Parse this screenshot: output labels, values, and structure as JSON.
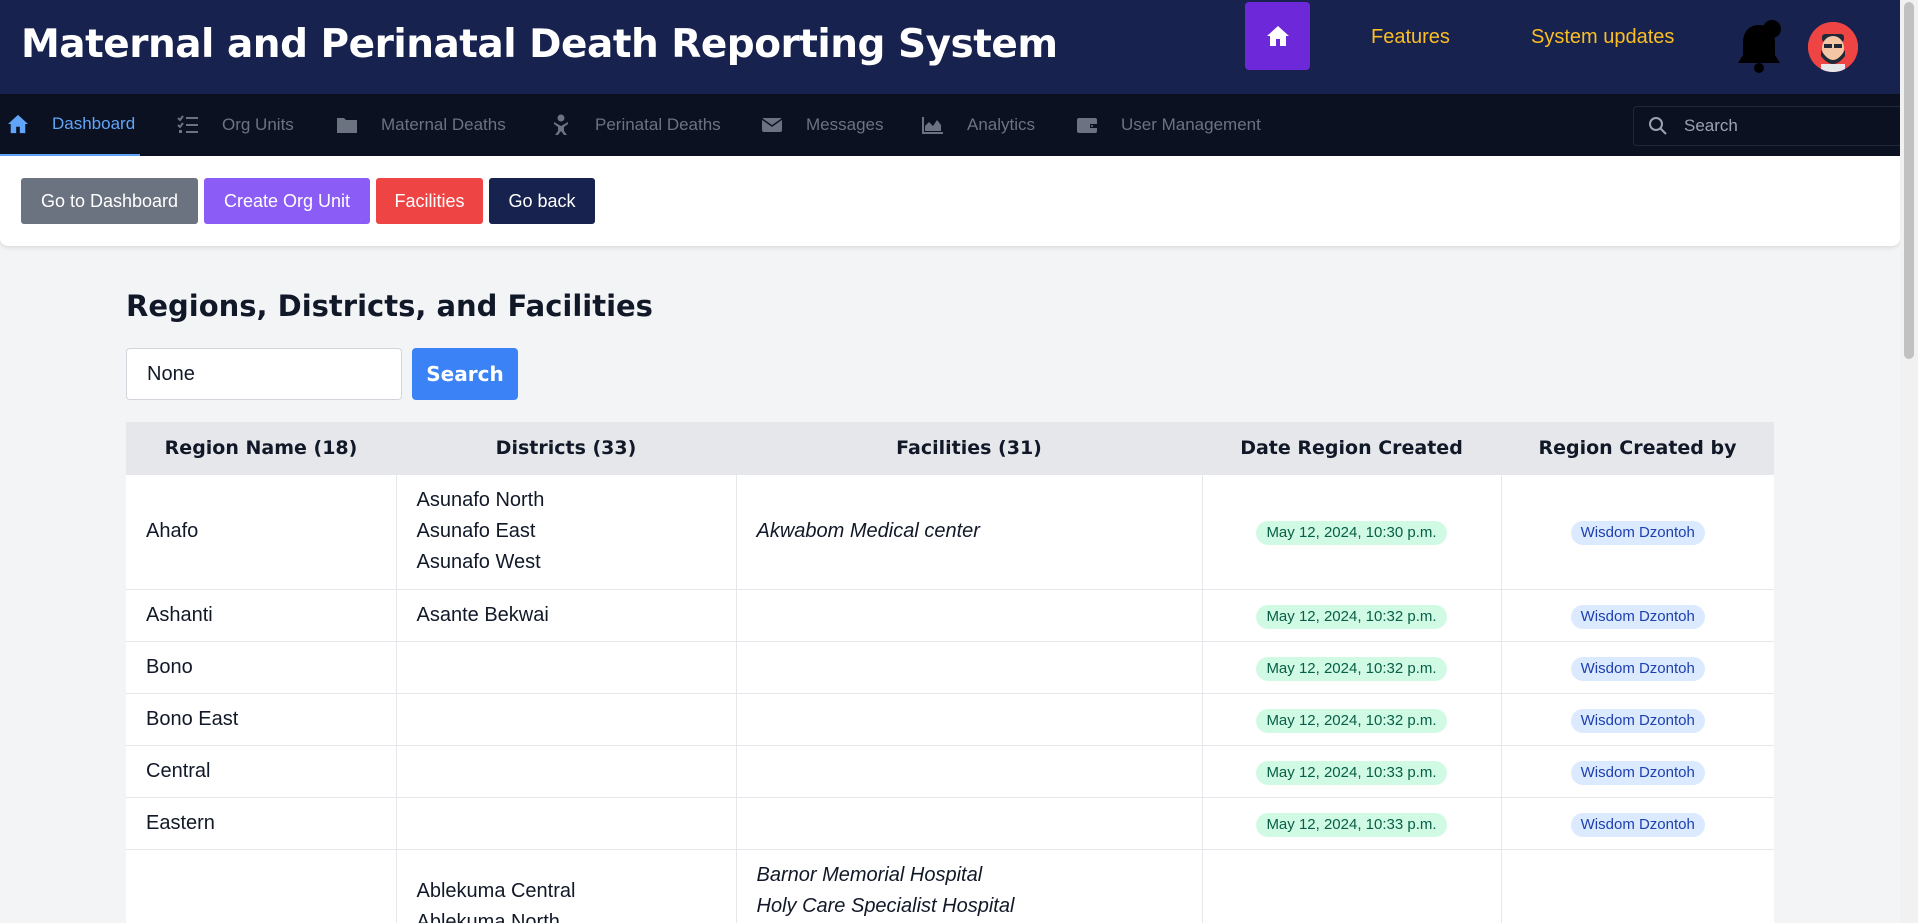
{
  "header": {
    "app_title": "Maternal and Perinatal Death Reporting System",
    "links": [
      "Features",
      "System updates"
    ],
    "icons": [
      "home-icon",
      "bell-icon",
      "avatar"
    ]
  },
  "nav": {
    "items": [
      {
        "label": "Dashboard",
        "icon": "home-icon",
        "active": true
      },
      {
        "label": "Org Units",
        "icon": "list-check-icon"
      },
      {
        "label": "Maternal Deaths",
        "icon": "folder-icon"
      },
      {
        "label": "Perinatal Deaths",
        "icon": "baby-icon"
      },
      {
        "label": "Messages",
        "icon": "envelope-icon"
      },
      {
        "label": "Analytics",
        "icon": "chart-area-icon"
      },
      {
        "label": "User Management",
        "icon": "wallet-icon"
      }
    ],
    "search_placeholder": "Search"
  },
  "actions": {
    "go_dashboard": "Go to Dashboard",
    "create_org": "Create Org Unit",
    "facilities": "Facilities",
    "go_back": "Go back"
  },
  "colors": {
    "header_bg": "#17224f",
    "nav_bg": "#0b1120",
    "accent_purple": "#6d28d9",
    "link_yellow": "#fbbf24",
    "btn_gray": "#6b7280",
    "btn_purple": "#8b5cf6",
    "btn_red": "#ef4444",
    "btn_navy": "#17224f",
    "btn_blue": "#3b82f6"
  },
  "main": {
    "heading": "Regions, Districts, and Facilities",
    "search_value": "None",
    "search_button": "Search",
    "table": {
      "headers": [
        "Region Name (18)",
        "Districts (33)",
        "Facilities (31)",
        "Date Region Created",
        "Region Created by"
      ],
      "rows": [
        {
          "region": "Ahafo",
          "districts": [
            "Asunafo North",
            "Asunafo East",
            "Asunafo West"
          ],
          "facilities": [
            "Akwabom Medical center"
          ],
          "date": "May 12, 2024, 10:30 p.m.",
          "created_by": "Wisdom Dzontoh"
        },
        {
          "region": "Ashanti",
          "districts": [
            "Asante Bekwai"
          ],
          "facilities": [],
          "date": "May 12, 2024, 10:32 p.m.",
          "created_by": "Wisdom Dzontoh"
        },
        {
          "region": "Bono",
          "districts": [],
          "facilities": [],
          "date": "May 12, 2024, 10:32 p.m.",
          "created_by": "Wisdom Dzontoh"
        },
        {
          "region": "Bono East",
          "districts": [],
          "facilities": [],
          "date": "May 12, 2024, 10:32 p.m.",
          "created_by": "Wisdom Dzontoh"
        },
        {
          "region": "Central",
          "districts": [],
          "facilities": [],
          "date": "May 12, 2024, 10:33 p.m.",
          "created_by": "Wisdom Dzontoh"
        },
        {
          "region": "Eastern",
          "districts": [],
          "facilities": [],
          "date": "May 12, 2024, 10:33 p.m.",
          "created_by": "Wisdom Dzontoh"
        },
        {
          "region": "",
          "districts": [
            "Ablekuma Central",
            "Ablekuma North"
          ],
          "facilities": [
            "Barnor Memorial Hospital",
            "Holy Care Specialist Hospital"
          ],
          "date": "",
          "created_by": ""
        }
      ]
    }
  }
}
